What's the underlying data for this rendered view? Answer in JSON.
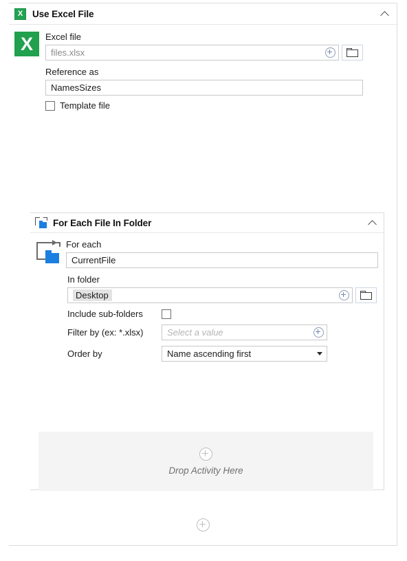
{
  "outer_activity": {
    "icon": "excel-icon",
    "title": "Use Excel File",
    "collapse_icon": "chevron-up-icon",
    "accent_color": "#13817b",
    "excel_file": {
      "label": "Excel file",
      "value": "files.xlsx",
      "add_icon": "plus-circle-icon",
      "browse_icon": "folder-icon"
    },
    "reference_as": {
      "label": "Reference as",
      "value": "NamesSizes"
    },
    "template_file": {
      "label": "Template file",
      "checked": false
    }
  },
  "add_buttons": {
    "icon": "plus-circle-icon",
    "top_label": "",
    "bottom_label": ""
  },
  "nested_activity": {
    "icon": "for-each-folder-icon",
    "title": "For Each File In Folder",
    "collapse_icon": "chevron-up-icon",
    "accent_color": "#2b3a9e",
    "for_each": {
      "label": "For each",
      "value": "CurrentFile"
    },
    "in_folder": {
      "label": "In folder",
      "value": "Desktop",
      "add_icon": "plus-circle-icon",
      "browse_icon": "folder-icon"
    },
    "include_subfolders": {
      "label": "Include sub-folders",
      "checked": false
    },
    "filter_by": {
      "label": "Filter by (ex: *.xlsx)",
      "value": "",
      "placeholder": "Select a value",
      "add_icon": "plus-circle-icon"
    },
    "order_by": {
      "label": "Order by",
      "value": "Name ascending first",
      "caret_icon": "chevron-down-icon"
    },
    "drop_zone": {
      "icon": "plus-circle-icon",
      "label": "Drop Activity Here"
    }
  }
}
